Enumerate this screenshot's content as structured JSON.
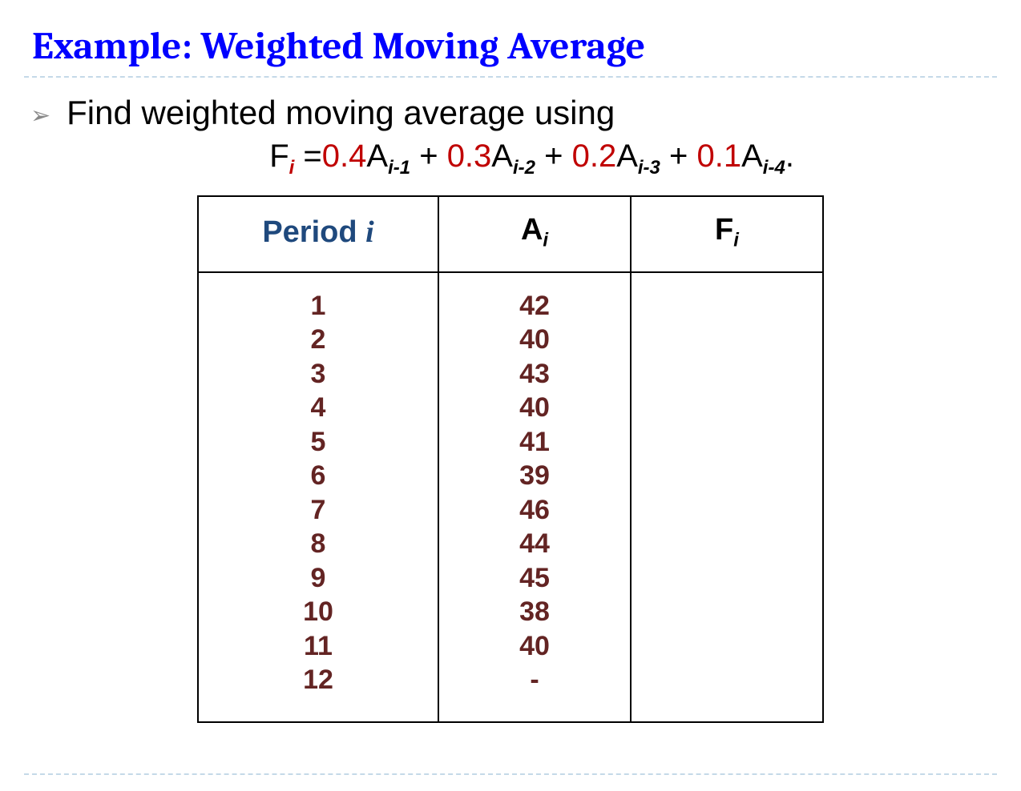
{
  "title": "Example: Weighted Moving Average",
  "bullet": "Find weighted moving average using",
  "formula": {
    "lhs_var": "F",
    "lhs_sub": "i",
    "eq": "=",
    "terms": [
      {
        "coef": "0.4",
        "var": "A",
        "sub": "i-1"
      },
      {
        "coef": "0.3",
        "var": "A",
        "sub": "i-2"
      },
      {
        "coef": "0.2",
        "var": "A",
        "sub": "i-3"
      },
      {
        "coef": "0.1",
        "var": "A",
        "sub": "i-4"
      }
    ],
    "plus": " + ",
    "end": "."
  },
  "table": {
    "headers": {
      "period_pre": "Period ",
      "period_i": "i",
      "ai_var": "A",
      "ai_sub": "i",
      "fi_var": "F",
      "fi_sub": "i"
    },
    "rows": [
      {
        "period": "1",
        "A": "42",
        "F": ""
      },
      {
        "period": "2",
        "A": "40",
        "F": ""
      },
      {
        "period": "3",
        "A": "43",
        "F": ""
      },
      {
        "period": "4",
        "A": "40",
        "F": ""
      },
      {
        "period": "5",
        "A": "41",
        "F": ""
      },
      {
        "period": "6",
        "A": "39",
        "F": ""
      },
      {
        "period": "7",
        "A": "46",
        "F": ""
      },
      {
        "period": "8",
        "A": "44",
        "F": ""
      },
      {
        "period": "9",
        "A": "45",
        "F": ""
      },
      {
        "period": "10",
        "A": "38",
        "F": ""
      },
      {
        "period": "11",
        "A": "40",
        "F": ""
      },
      {
        "period": "12",
        "A": "-",
        "F": ""
      }
    ]
  },
  "chevron": "➢"
}
